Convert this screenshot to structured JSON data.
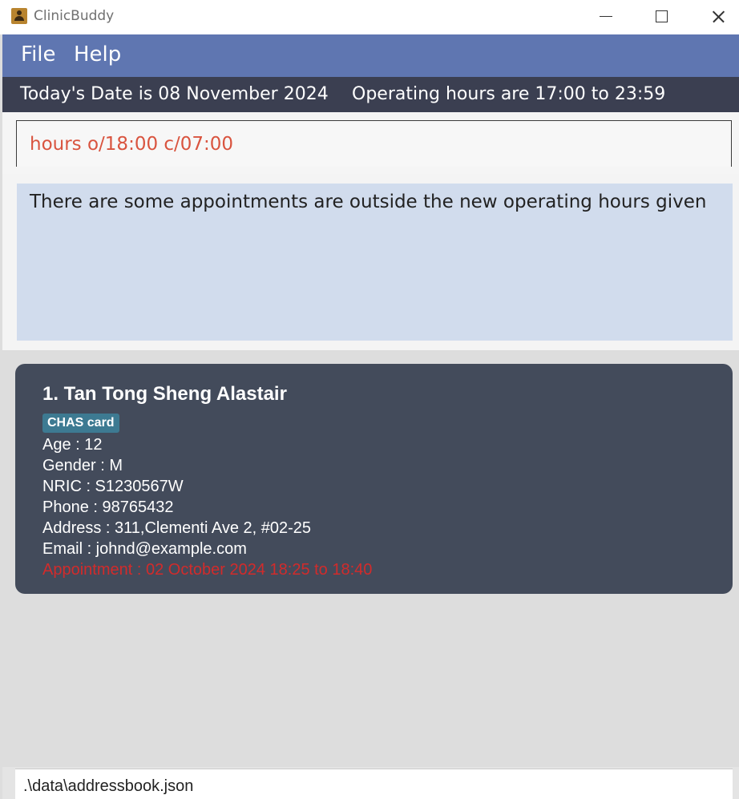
{
  "window": {
    "title": "ClinicBuddy"
  },
  "menu": {
    "items": [
      "File",
      "Help"
    ]
  },
  "status": {
    "date_text": "Today's Date is 08 November 2024",
    "hours_text": "Operating hours are 17:00 to 23:59"
  },
  "command": {
    "value": "hours o/18:00 c/07:00"
  },
  "result": {
    "message": "There are some appointments are outside the new operating hours given"
  },
  "persons": [
    {
      "index_name": "1. Tan Tong Sheng Alastair",
      "tag": "CHAS card",
      "age": "Age : 12",
      "gender": "Gender : M",
      "nric": "NRIC : S1230567W",
      "phone": "Phone : 98765432",
      "address": "Address : 311,Clementi Ave 2, #02-25",
      "email": "Email : johnd@example.com",
      "appointment": "Appointment : 02 October 2024 18:25 to 18:40"
    }
  ],
  "footer": {
    "file_path": ".\\data\\addressbook.json"
  },
  "colors": {
    "menubar": "#5f76b1",
    "statusbar": "#3b3f51",
    "command_text": "#d9543f",
    "result_bg": "#d1dced",
    "card_bg": "#434b5b",
    "tag_bg": "#3d7a92",
    "appointment_warning": "#d22b2b"
  }
}
